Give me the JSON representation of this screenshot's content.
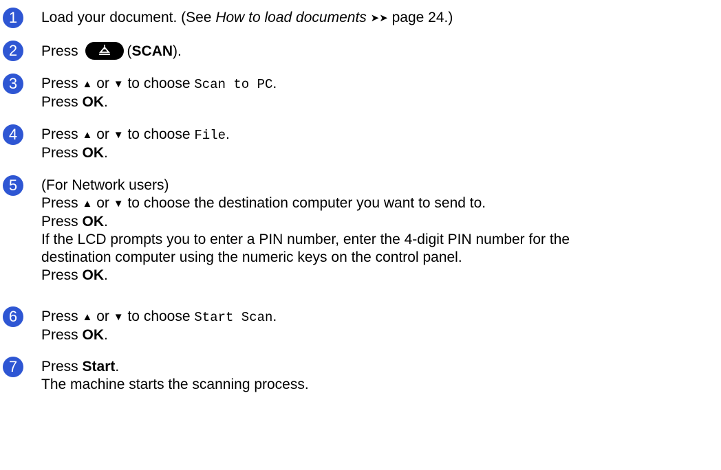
{
  "steps": [
    {
      "number": "1",
      "lines": [
        {
          "pre": "Load your document. (See ",
          "link": "How to load documents",
          "arrows": "➤➤",
          "post": " page 24.)"
        }
      ]
    },
    {
      "number": "2",
      "pre": "Press",
      "icon": "scan-icon",
      "open": "(",
      "key": "SCAN",
      "close": ")."
    },
    {
      "number": "3",
      "pre": "Press",
      "up": "▲",
      "or": "or",
      "down": "▼",
      "choose": "to choose",
      "option": "Scan to PC",
      "end": ".",
      "press": "Press",
      "ok": "OK",
      "dot": "."
    },
    {
      "number": "4",
      "pre": "Press",
      "up": "▲",
      "or": "or",
      "down": "▼",
      "choose": "to choose",
      "option": "File",
      "end": ".",
      "press": "Press",
      "ok": "OK",
      "dot": "."
    },
    {
      "number": "5",
      "l1": "(For Network users)",
      "l2a": "Press",
      "up": "▲",
      "or": "or",
      "down": "▼",
      "l2b": "to choose the destination computer you want to send to.",
      "press": "Press",
      "ok": "OK",
      "dot": ".",
      "l4": "If the LCD prompts you to enter a PIN number, enter the 4-digit PIN number for the",
      "l5": "destination computer using the numeric keys on the control panel."
    },
    {
      "number": "6",
      "pre": "Press",
      "up": "▲",
      "or": "or",
      "down": "▼",
      "choose": "to choose",
      "option": "Start Scan",
      "end": ".",
      "press": "Press",
      "ok": "OK",
      "dot": "."
    },
    {
      "number": "7",
      "press": "Press",
      "key": "Start",
      "dot": ".",
      "l2": "The machine starts the scanning process."
    }
  ]
}
